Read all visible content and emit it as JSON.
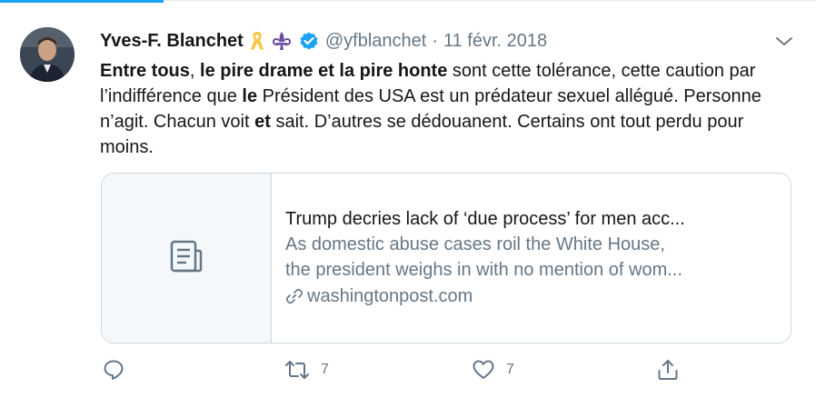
{
  "author": {
    "name": "Yves-F. Blanchet",
    "handle": "@yfblanchet",
    "separator": "·",
    "date": "11 févr. 2018",
    "badges": [
      "yellow-ribbon-icon",
      "fleur-de-lis-icon",
      "verified-badge-icon"
    ]
  },
  "tweet": {
    "segments": [
      {
        "text": "Entre tous",
        "bold": true
      },
      {
        "text": ", ",
        "bold": false
      },
      {
        "text": "le pire drame et la pire honte",
        "bold": true
      },
      {
        "text": " sont cette tolérance, cette caution par l’indifférence que ",
        "bold": false
      },
      {
        "text": "le",
        "bold": true
      },
      {
        "text": " Président des USA est un prédateur sexuel allégué. Personne n’agit. Chacun voit ",
        "bold": false
      },
      {
        "text": "et",
        "bold": true
      },
      {
        "text": " sait. D’autres se dédouanent. Certains ont tout perdu pour moins.",
        "bold": false
      }
    ]
  },
  "card": {
    "title": "Trump decries lack of ‘due process’ for men acc...",
    "description_line1": "As domestic abuse cases roil the White House,",
    "description_line2": "the president weighs in with no mention of wom...",
    "domain": "washingtonpost.com"
  },
  "actions": {
    "reply_count": "",
    "retweet_count": "7",
    "like_count": "7"
  },
  "colors": {
    "accent": "#1da1f2",
    "text": "#14171a",
    "secondary": "#657786",
    "border": "#ccd6dd",
    "verified": "#1da1f2",
    "ribbon": "#f7c744",
    "fleur": "#6b4ea1"
  }
}
